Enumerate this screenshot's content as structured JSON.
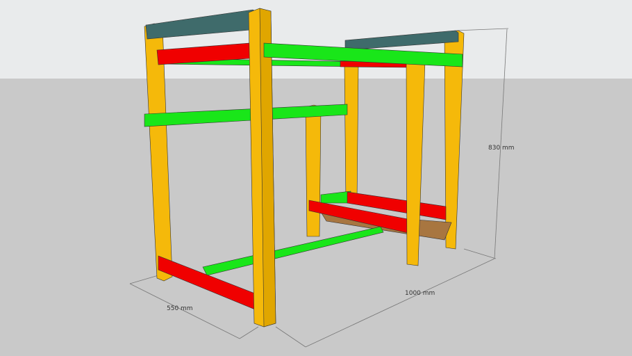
{
  "model": {
    "dimensions": {
      "width_label": "550 mm",
      "length_label": "1000 mm",
      "height_label": "830 mm"
    }
  },
  "colors": {
    "sky": "#e9ebec",
    "ground": "#c9c9c9",
    "post": "#f5b90a",
    "post_shade": "#d99c00",
    "beam_red": "#f00000",
    "beam_green": "#19e619",
    "beam_teal": "#3f6b6b",
    "shelf": "#a87640",
    "dim_line": "#777777"
  }
}
